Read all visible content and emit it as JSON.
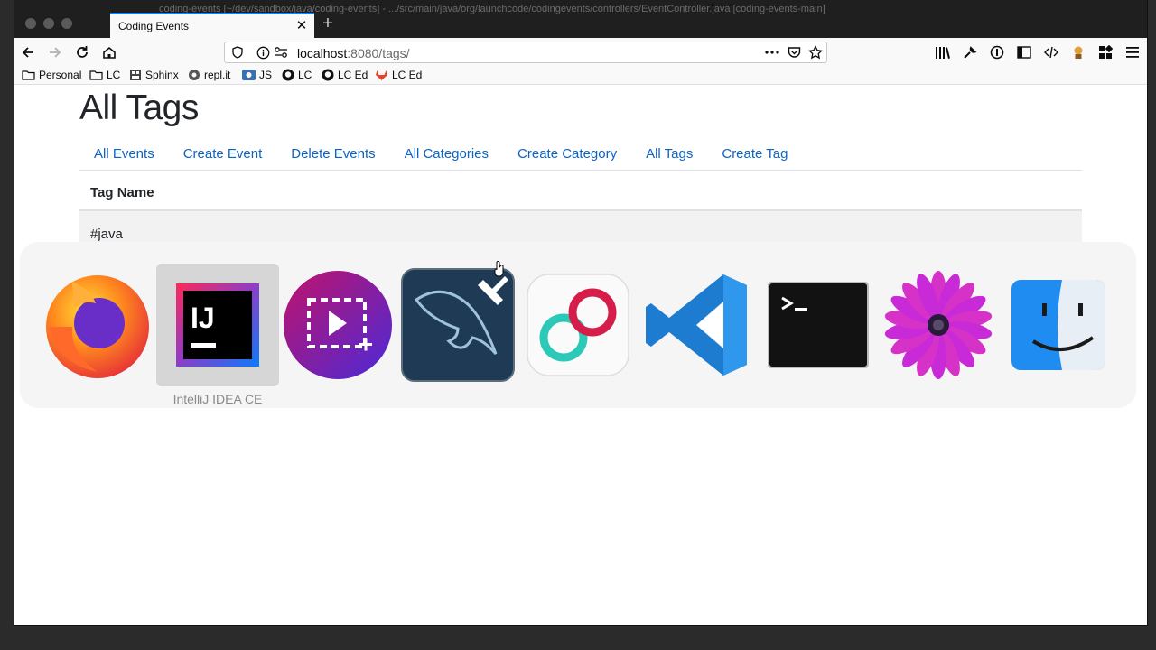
{
  "window": {
    "title": "coding-events [~/dev/sandbox/java/coding-events] - .../src/main/java/org/launchcode/codingevents/controllers/EventController.java [coding-events-main]"
  },
  "browser": {
    "tab_title": "Coding Events",
    "url_host": "localhost",
    "url_rest": ":8080/tags/"
  },
  "bookmarks": [
    {
      "label": "Personal"
    },
    {
      "label": "LC"
    },
    {
      "label": "Sphinx"
    },
    {
      "label": "repl.it"
    },
    {
      "label": "JS"
    },
    {
      "label": "LC"
    },
    {
      "label": "LC Ed"
    },
    {
      "label": "LC Ed"
    }
  ],
  "page": {
    "heading": "All Tags",
    "nav": [
      "All Events",
      "Create Event",
      "Delete Events",
      "All Categories",
      "Create Category",
      "All Tags",
      "Create Tag"
    ],
    "table": {
      "header": "Tag Name",
      "rows": [
        "#java"
      ]
    }
  },
  "app_switcher": {
    "apps": [
      {
        "icon": "firefox-icon"
      },
      {
        "icon": "intellij-idea-icon",
        "label": "IntelliJ IDEA CE",
        "selected": true
      },
      {
        "icon": "screen-recorder-icon"
      },
      {
        "icon": "mysql-workbench-icon"
      },
      {
        "icon": "infinity-app-icon"
      },
      {
        "icon": "vscode-icon"
      },
      {
        "icon": "terminal-icon"
      },
      {
        "icon": "flower-app-icon"
      },
      {
        "icon": "finder-icon"
      }
    ]
  },
  "colors": {
    "link": "#0b64c4",
    "tab_accent": "#0a84ff"
  }
}
